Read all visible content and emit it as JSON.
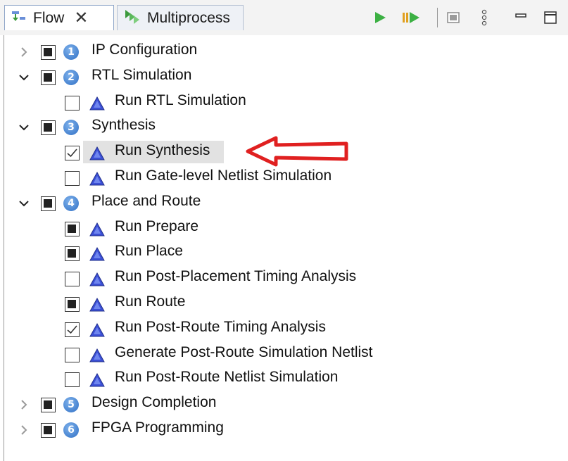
{
  "tabs": [
    {
      "label": "Flow",
      "active": true,
      "icon": "flow-icon"
    },
    {
      "label": "Multiprocess",
      "active": false,
      "icon": "multiprocess-icon"
    }
  ],
  "toolbar": {
    "run_icon": "play-icon",
    "run_selected_icon": "run-to-icon",
    "stop_icon": "stop-icon",
    "menu_icon": "view-menu-icon",
    "minimize_icon": "minimize-icon",
    "maximize_icon": "maximize-icon"
  },
  "tree": {
    "steps": [
      {
        "number": "1",
        "label": "IP Configuration",
        "expanded": false,
        "checked": "partial"
      },
      {
        "number": "2",
        "label": "RTL Simulation",
        "expanded": true,
        "checked": "partial",
        "tasks": [
          {
            "label": "Run RTL Simulation",
            "checked": "none"
          }
        ]
      },
      {
        "number": "3",
        "label": "Synthesis",
        "expanded": true,
        "checked": "partial",
        "tasks": [
          {
            "label": "Run Synthesis",
            "checked": "checked",
            "selected": true
          },
          {
            "label": "Run Gate-level Netlist Simulation",
            "checked": "none"
          }
        ]
      },
      {
        "number": "4",
        "label": "Place and Route",
        "expanded": true,
        "checked": "partial",
        "tasks": [
          {
            "label": "Run Prepare",
            "checked": "partial"
          },
          {
            "label": "Run Place",
            "checked": "partial"
          },
          {
            "label": "Run Post-Placement Timing Analysis",
            "checked": "none"
          },
          {
            "label": "Run Route",
            "checked": "partial"
          },
          {
            "label": "Run Post-Route Timing Analysis",
            "checked": "checked"
          },
          {
            "label": "Generate Post-Route Simulation Netlist",
            "checked": "none"
          },
          {
            "label": "Run Post-Route Netlist Simulation",
            "checked": "none"
          }
        ]
      },
      {
        "number": "5",
        "label": "Design Completion",
        "expanded": false,
        "checked": "partial"
      },
      {
        "number": "6",
        "label": "FPGA Programming",
        "expanded": false,
        "checked": "partial"
      }
    ]
  },
  "annotation": {
    "type": "arrow",
    "color": "#e02020",
    "points_to": "Run Synthesis"
  },
  "colors": {
    "play": "#3cb043",
    "step_badge": "#2f6fc4",
    "task_triangle": "#3b4fd6",
    "arrow": "#e02020"
  }
}
